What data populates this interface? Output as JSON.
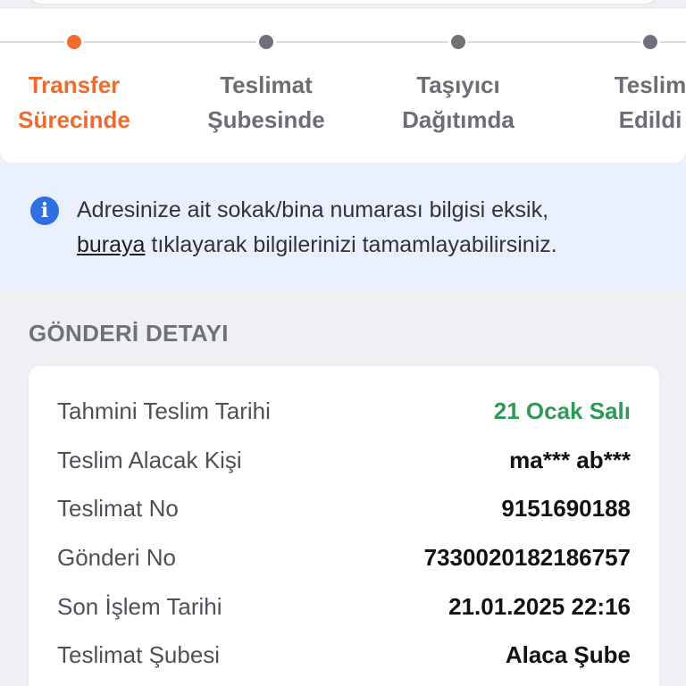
{
  "stepper": {
    "steps": [
      {
        "line1": "Transfer",
        "line2": "Sürecinde",
        "active": true
      },
      {
        "line1": "Teslimat",
        "line2": "Şubesinde",
        "active": false
      },
      {
        "line1": "Taşıyıcı",
        "line2": "Dağıtımda",
        "active": false
      },
      {
        "line1": "Teslim",
        "line2": "Edildi",
        "active": false
      }
    ]
  },
  "info_banner": {
    "icon": "info-icon",
    "text_before": "Adresinize ait sokak/bina numarası bilgisi eksik,",
    "link_text": "buraya",
    "text_after": " tıklayarak bilgilerinizi tamamlayabilirsiniz."
  },
  "section": {
    "title": "GÖNDERİ DETAYI"
  },
  "details": [
    {
      "label": "Tahmini Teslim Tarihi",
      "value": "21 Ocak Salı"
    },
    {
      "label": "Teslim Alacak Kişi",
      "value": "ma*** ab***"
    },
    {
      "label": "Teslimat No",
      "value": "9151690188"
    },
    {
      "label": "Gönderi No",
      "value": "7330020182186757"
    },
    {
      "label": "Son İşlem Tarihi",
      "value": "21.01.2025 22:16"
    },
    {
      "label": "Teslimat Şubesi",
      "value": "Alaca Şube"
    }
  ],
  "colors": {
    "accent": "#ee6a2d",
    "inactive": "#6e7278",
    "success": "#2f9a56",
    "info": "#2f6fe4",
    "banner_bg": "#e9f0fc"
  }
}
